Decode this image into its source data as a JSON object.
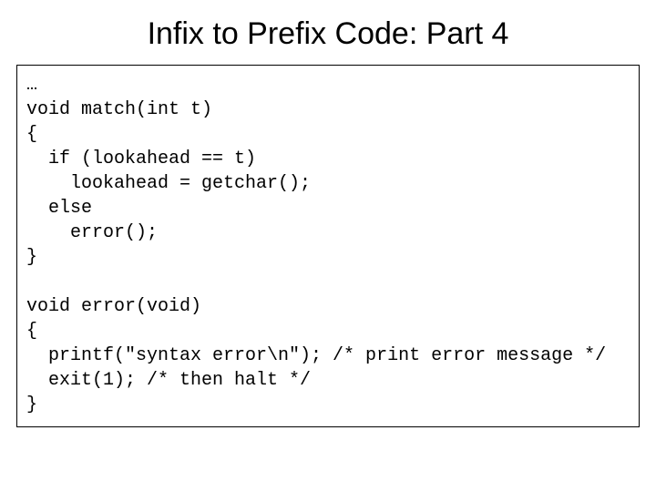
{
  "title": "Infix to Prefix Code: Part 4",
  "code": "…\nvoid match(int t)\n{\n  if (lookahead == t)\n    lookahead = getchar();\n  else\n    error();\n}\n\nvoid error(void)\n{\n  printf(\"syntax error\\n\"); /* print error message */\n  exit(1); /* then halt */\n}"
}
